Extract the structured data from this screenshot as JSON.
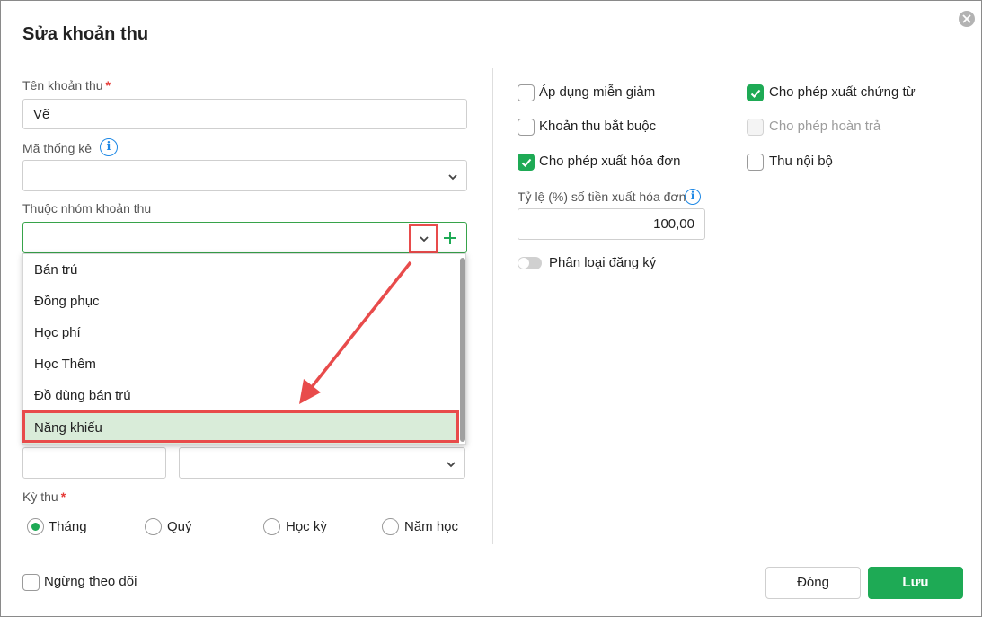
{
  "dialog": {
    "title": "Sửa khoản thu"
  },
  "form": {
    "name_label": "Tên khoản thu",
    "required_mark": "*",
    "name_value": "Vẽ",
    "stat_code_label": "Mã thống kê",
    "stat_code_value": "",
    "group_label": "Thuộc nhóm khoản thu",
    "group_value": "",
    "group_options": [
      "Bán trú",
      "Đồng phục",
      "Học phí",
      "Học Thêm",
      "Đồ dùng bán trú",
      "Năng khiếu"
    ],
    "group_selected_index": 5,
    "amount_value": "",
    "unit_value": "",
    "period_label": "Kỳ thu",
    "period_options": [
      "Tháng",
      "Quý",
      "Học kỳ",
      "Năm học"
    ],
    "period_selected_index": 0,
    "stop_tracking_label": "Ngừng theo dõi"
  },
  "options": {
    "apply_discount": {
      "label": "Áp dụng miễn giảm",
      "checked": false
    },
    "allow_voucher": {
      "label": "Cho phép xuất chứng từ",
      "checked": true
    },
    "mandatory": {
      "label": "Khoản thu bắt buộc",
      "checked": false
    },
    "allow_refund": {
      "label": "Cho phép hoàn trả",
      "checked": false,
      "disabled": true
    },
    "allow_invoice": {
      "label": "Cho phép xuất hóa đơn",
      "checked": true
    },
    "internal": {
      "label": "Thu nội bộ",
      "checked": false
    },
    "invoice_rate_label": "Tỷ lệ (%) số tiền xuất hóa đơn",
    "invoice_rate_value": "100,00",
    "registration_label": "Phân loại đăng ký",
    "registration_on": false
  },
  "buttons": {
    "close_label": "Đóng",
    "save_label": "Lưu"
  },
  "colors": {
    "accent": "#1eaa55",
    "highlight": "#e84b4b",
    "info": "#1e88e5"
  }
}
